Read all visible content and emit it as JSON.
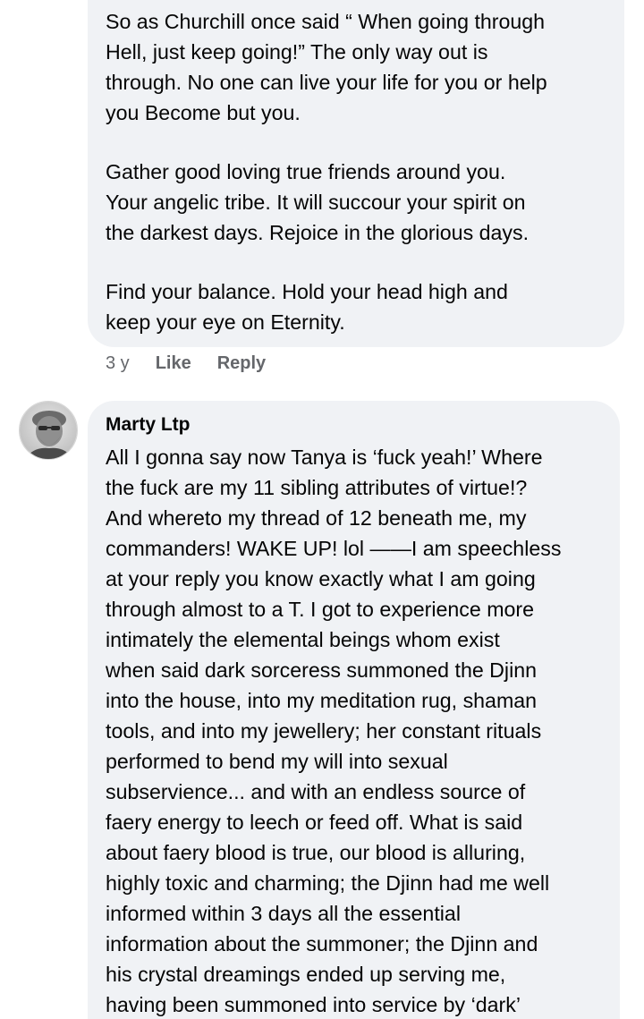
{
  "comment1": {
    "paragraphs": [
      [
        "So as Churchill once said “ When going through",
        "Hell, just keep going!” The only way out is",
        "through. No one can live your life for you or help",
        "you Become but you."
      ],
      [
        "Gather good loving true friends around you.",
        "Your angelic tribe.  It will succour your spirit on",
        "the darkest days.  Rejoice in the glorious days."
      ],
      [
        "Find your balance.  Hold your head high and",
        "keep your eye on Eternity."
      ]
    ],
    "time": "3 y",
    "like_label": "Like",
    "reply_label": "Reply"
  },
  "comment2": {
    "author": "Marty Ltp",
    "avatar_icon": "user-avatar",
    "lines": [
      "All I gonna say now Tanya is ‘fuck yeah!’ Where",
      "the fuck are my 11 sibling attributes of virtue!?",
      "And whereto my thread of 12 beneath me, my",
      "commanders! WAKE UP! lol ——I am speechless",
      "at your reply you know exactly what I am going",
      "through almost to a T. I got to experience more",
      "intimately the elemental beings whom exist",
      "when said dark sorceress summoned the Djinn",
      "into the house, into my meditation rug, shaman",
      "tools, and into my jewellery; her constant rituals",
      "performed to bend my will into sexual",
      "subservience... and with an endless source of",
      "faery energy to leech or feed off. What is said",
      "about faery blood is true, our blood is alluring,",
      "highly toxic and charming; the Djinn had me well",
      "informed within 3 days all the essential",
      "information about the summoner; the Djinn and",
      "his crystal dreamings ended up serving me,",
      "having been summoned into service by ‘dark’"
    ]
  },
  "colors": {
    "bubble_bg": "#f0f2f5",
    "meta_text": "#65676b",
    "body_text": "#050505"
  }
}
